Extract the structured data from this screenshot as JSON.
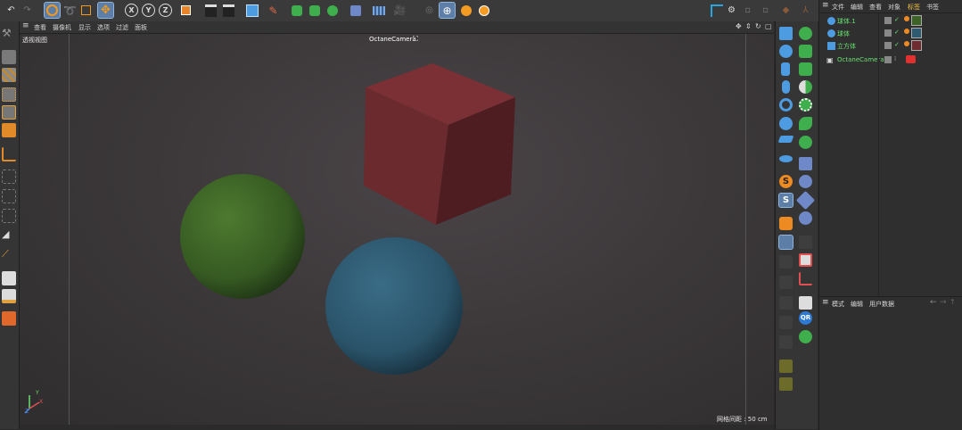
{
  "top_toolbar": {
    "axis_buttons": [
      "X",
      "Y",
      "Z"
    ]
  },
  "viewport": {
    "menu": [
      "查看",
      "摄像机",
      "显示",
      "选项",
      "过滤",
      "面板"
    ],
    "view_name": "透视视图",
    "camera_label": "OctaneCamera",
    "grid_status": "网格间距 : 50 cm",
    "axis_labels": {
      "y": "Y",
      "x": "X",
      "z": "Z"
    }
  },
  "right_tools": {
    "s_buttons": [
      "S",
      "S"
    ],
    "qr_label": "QR"
  },
  "object_manager": {
    "menu": [
      "文件",
      "编辑",
      "查看",
      "对象",
      "标签",
      "书签"
    ],
    "objects": [
      {
        "name": "球体.1",
        "icon": "sphere-icon"
      },
      {
        "name": "球体",
        "icon": "sphere-icon"
      },
      {
        "name": "立方体",
        "icon": "cube-icon"
      },
      {
        "name": "OctaneCamera",
        "icon": "camera-icon"
      }
    ]
  },
  "attribute_manager": {
    "menu": [
      "模式",
      "编辑",
      "用户数据"
    ]
  },
  "colors": {
    "accent": "#5d7ea6",
    "name_green": "#67e06f",
    "cube": "#6e2b30",
    "sphere_green": "#3d6426",
    "sphere_blue": "#2e5a72"
  }
}
